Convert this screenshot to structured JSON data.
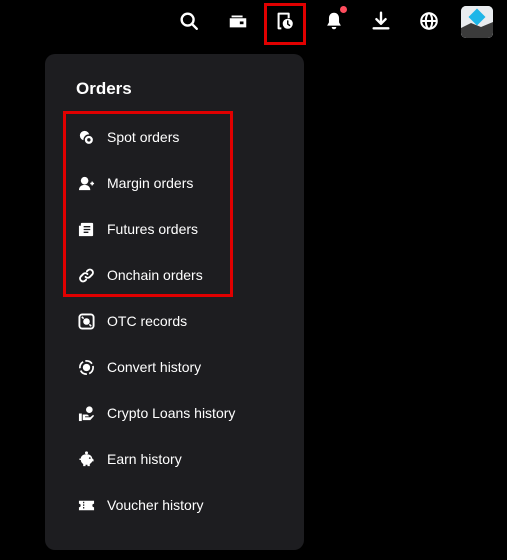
{
  "colors": {
    "background": "#000000",
    "menu_background": "#1d1d20",
    "text": "#ffffff",
    "highlight_red": "#e00000",
    "notification_dot": "#ff4d5e",
    "avatar_accent": "#1fb6e8"
  },
  "topbar": {
    "icons": [
      "search-icon",
      "wallet-icon",
      "orders-history-icon",
      "bell-icon",
      "download-icon",
      "globe-icon",
      "avatar"
    ]
  },
  "menu": {
    "title": "Orders",
    "items": [
      {
        "label": "Spot orders",
        "icon": "spot-orders-icon"
      },
      {
        "label": "Margin orders",
        "icon": "margin-orders-icon"
      },
      {
        "label": "Futures orders",
        "icon": "futures-orders-icon"
      },
      {
        "label": "Onchain orders",
        "icon": "onchain-link-icon"
      },
      {
        "label": "OTC records",
        "icon": "otc-records-icon"
      },
      {
        "label": "Convert history",
        "icon": "convert-history-icon"
      },
      {
        "label": "Crypto Loans history",
        "icon": "crypto-loans-icon"
      },
      {
        "label": "Earn history",
        "icon": "piggy-bank-icon"
      },
      {
        "label": "Voucher history",
        "icon": "voucher-ticket-icon"
      }
    ]
  }
}
